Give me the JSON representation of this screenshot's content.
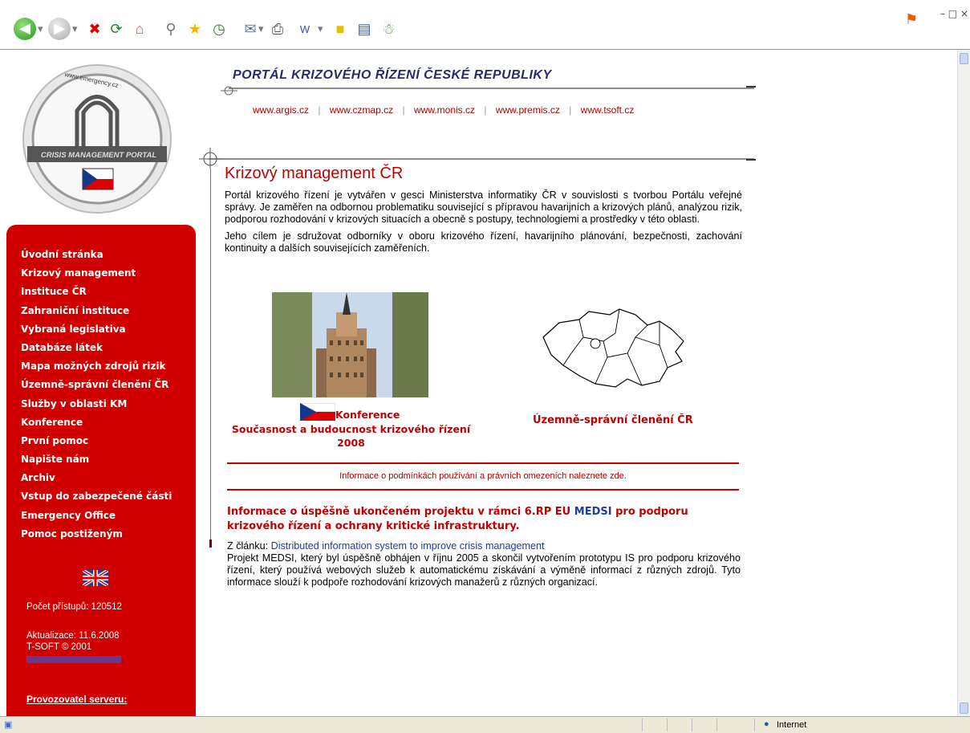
{
  "browser": {
    "status_text": "Internet",
    "window_controls": [
      "–",
      "□",
      "×"
    ]
  },
  "header": {
    "title": "PORTÁL KRIZOVÉHO ŘÍZENÍ ČESKÉ REPUBLIKY",
    "links": [
      "www.argis.cz",
      "www.czmap.cz",
      "www.monis.cz",
      "www.premis.cz",
      "www.tsoft.cz"
    ],
    "separator": "|"
  },
  "logo": {
    "top_text": "www.emergency.cz",
    "band_text": "CRISIS MANAGEMENT PORTAL"
  },
  "sidebar": {
    "items": [
      "Úvodní stránka",
      "Krizový management",
      "Instituce ČR",
      "Zahraniční instituce",
      "Vybraná legislativa",
      "Databáze látek",
      "Mapa možných zdrojů rizik",
      "Územně-správní členění ČR",
      "Služby v oblasti KM",
      "Konference",
      "První pomoc",
      "Napište nám",
      "Archiv",
      "Vstup do zabezpečené části",
      "Emergency Office",
      "Pomoc postiženým"
    ],
    "counter": "Počet přístupů: 120512",
    "updated": "Aktualizace: 11.6.2008",
    "copyright": "T-SOFT © 2001",
    "provider": "Provozovatel serveru:"
  },
  "main": {
    "heading": "Krizový management ČR",
    "para1": "Portál krizového řízení je vytvářen v gesci Ministerstva informatiky ČR v souvislosti s tvorbou Portálu veřejné správy. Je zaměřen na odbornou problematiku související s přípravou havarijních a krizových plánů, analýzou rizik, podporou rozhodování v krizových situacích a obecně s postupy, technologiemi a prostředky v této oblasti.",
    "para2": "Jeho cílem je sdružovat odborníky v oboru krizového řízení, havarijního plánování, bezpečnosti, zachování kontinuity a dalších souvisejících zaměřeních.",
    "conference_label": "Konference",
    "conference_title": "Současnost a budoucnost krizového řízení",
    "conference_year": "2008",
    "map_caption": "Územně-správní členění ČR",
    "terms": "Informace o podmínkách používání a právních omezeních naleznete zde.",
    "news_title_pre": "Informace o úspěšně ukončeném projektu v rámci 6.RP EU ",
    "news_title_link": "MEDSI",
    "news_title_post": " pro podporu krizového řízení a ochrany kritické infrastruktury.",
    "article_prefix": "Z článku: ",
    "article_link": "Distributed information system to improve crisis management",
    "article_body": "Projekt MEDSI, který byl úspěšně obhájen v říjnu 2005 a skončil vytvořením prototypu IS pro podporu krizového řízení, který používá webových služeb k automatickému získávání a výměně informací z různých zdrojů. Tyto informace slouží k podpoře rozhodování krizových manažerů z různých organizací."
  },
  "colors": {
    "accent_red": "#d10000",
    "link_blue": "#1a3cad"
  }
}
